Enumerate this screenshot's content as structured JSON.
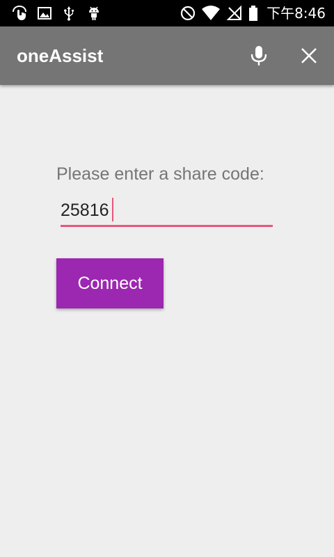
{
  "status_bar": {
    "time": "下午8:46",
    "icons_left": [
      "touch-assist-icon",
      "image-icon",
      "usb-icon",
      "android-icon"
    ],
    "icons_right": [
      "do-not-disturb-icon",
      "wifi-icon",
      "no-signal-icon",
      "battery-icon"
    ]
  },
  "app_bar": {
    "title": "oneAssist",
    "background": "#757575",
    "mic_icon": "mic-icon",
    "close_icon": "close-icon"
  },
  "form": {
    "prompt": "Please enter a share code:",
    "code_value": "25816",
    "accent_color": "#e8557d",
    "connect_label": "Connect",
    "button_color": "#9c27b0"
  }
}
